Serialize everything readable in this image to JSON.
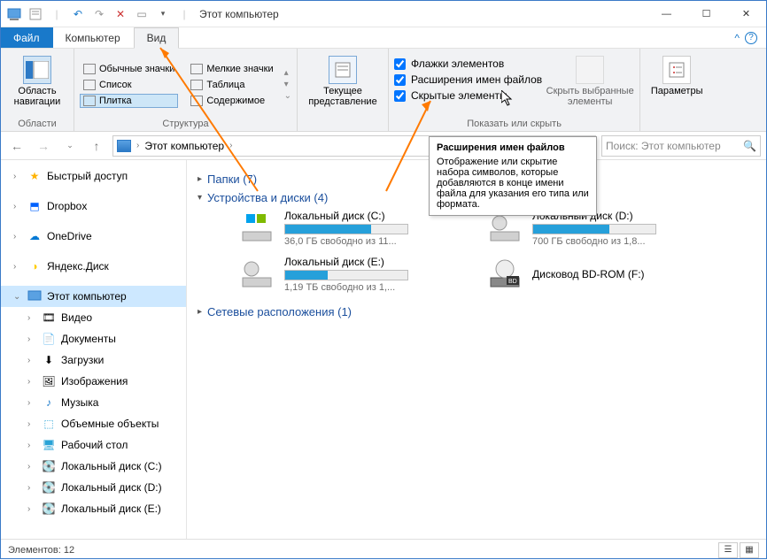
{
  "window": {
    "title": "Этот компьютер"
  },
  "menu": {
    "file": "Файл",
    "computer": "Компьютер",
    "view": "Вид"
  },
  "ribbon": {
    "nav_area": {
      "label": "Область навигации",
      "group": "Области"
    },
    "layout": {
      "group": "Структура",
      "regular": "Обычные значки",
      "small": "Мелкие значки",
      "list": "Список",
      "table": "Таблица",
      "tiles": "Плитка",
      "content": "Содержимое"
    },
    "current_view": "Текущее представление",
    "checkboxes": {
      "group": "Показать или скрыть",
      "flags": "Флажки элементов",
      "ext": "Расширения имен файлов",
      "hidden": "Скрытые элементы"
    },
    "hide_selected": "Скрыть выбранные элементы",
    "params": "Параметры"
  },
  "address": {
    "root": "Этот компьютер",
    "search_placeholder": "Поиск: Этот компьютер"
  },
  "nav": {
    "quick": "Быстрый доступ",
    "dropbox": "Dropbox",
    "onedrive": "OneDrive",
    "yadisk": "Яндекс.Диск",
    "thispc": "Этот компьютер",
    "video": "Видео",
    "documents": "Документы",
    "downloads": "Загрузки",
    "images": "Изображения",
    "music": "Музыка",
    "objects3d": "Объемные объекты",
    "desktop": "Рабочий стол",
    "diskC": "Локальный диск (C:)",
    "diskD": "Локальный диск (D:)",
    "diskE": "Локальный диск (E:)"
  },
  "sections": {
    "folders": "Папки (7)",
    "drives": "Устройства и диски (4)",
    "network": "Сетевые расположения (1)"
  },
  "drives": {
    "c": {
      "name": "Локальный диск (C:)",
      "free": "36,0 ГБ свободно из 11..."
    },
    "d": {
      "name": "Локальный диск (D:)",
      "free": "700 ГБ свободно из 1,8..."
    },
    "e": {
      "name": "Локальный диск (E:)",
      "free": "1,19 ТБ свободно из 1,..."
    },
    "f": {
      "name": "Дисковод BD-ROM (F:)"
    }
  },
  "status": {
    "items": "Элементов: 12"
  },
  "tooltip": {
    "title": "Расширения имен файлов",
    "body": "Отображение или скрытие набора символов, которые добавляются в конце имени файла для указания его типа или формата."
  }
}
